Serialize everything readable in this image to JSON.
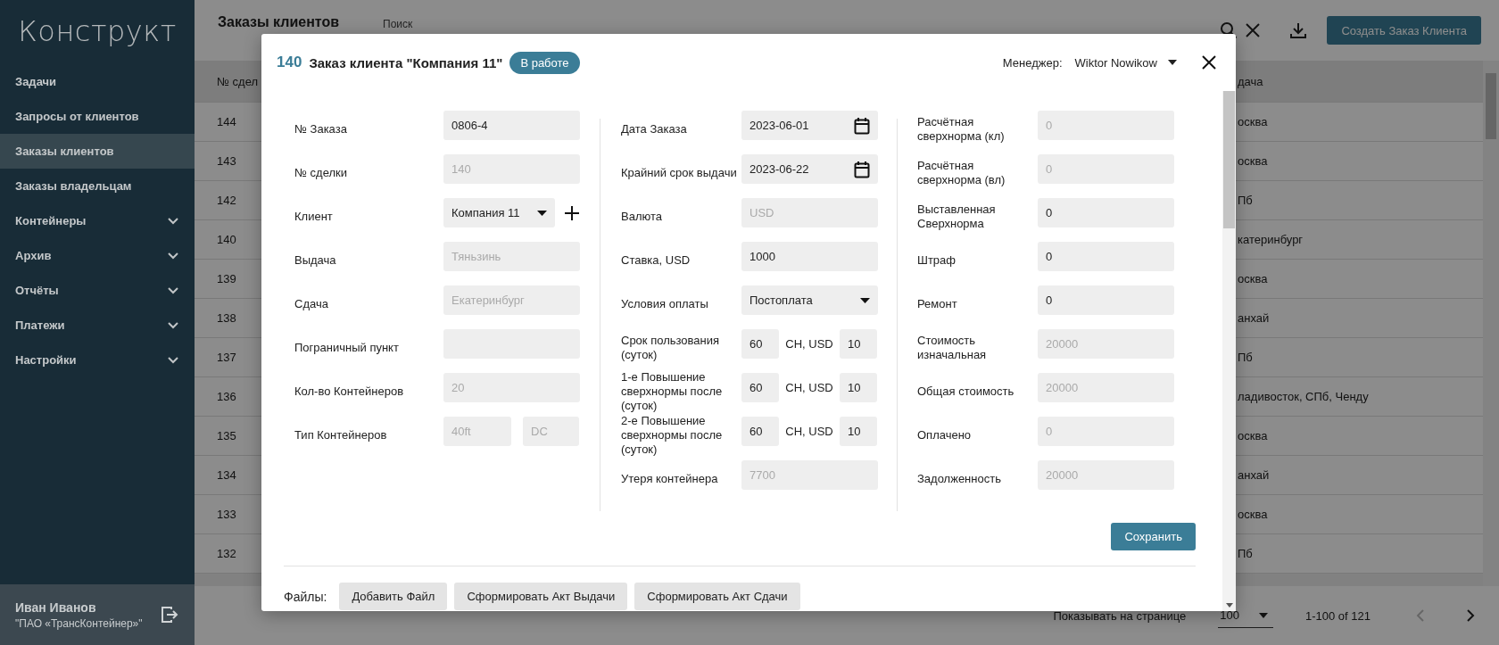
{
  "sidebar": {
    "logo": "Конструкт",
    "items": [
      {
        "label": "Задачи",
        "selected": false,
        "expandable": false
      },
      {
        "label": "Запросы от клиентов",
        "selected": false,
        "expandable": false
      },
      {
        "label": "Заказы клиентов",
        "selected": true,
        "expandable": false
      },
      {
        "label": "Заказы владельцам",
        "selected": false,
        "expandable": false
      },
      {
        "label": "Контейнеры",
        "selected": false,
        "expandable": true
      },
      {
        "label": "Архив",
        "selected": false,
        "expandable": true
      },
      {
        "label": "Отчёты",
        "selected": false,
        "expandable": true
      },
      {
        "label": "Платежи",
        "selected": false,
        "expandable": true
      },
      {
        "label": "Настройки",
        "selected": false,
        "expandable": true
      }
    ],
    "user": {
      "name": "Иван Иванов",
      "company": "\"ПАО «ТрансКонтейнер»\""
    }
  },
  "page": {
    "title": "Заказы клиентов",
    "search_placeholder": "Поиск",
    "create_button": "Создать Заказ Клиента"
  },
  "table": {
    "columns": [
      "№ сдел",
      "дача"
    ],
    "rows": [
      {
        "cells": [
          "144",
          "осква"
        ]
      },
      {
        "cells": [
          "143",
          "осква"
        ]
      },
      {
        "cells": [
          "142",
          "Пб"
        ]
      },
      {
        "cells": [
          "140",
          "катеринбург"
        ]
      },
      {
        "cells": [
          "139",
          "осква"
        ]
      },
      {
        "cells": [
          "138",
          "анхай"
        ]
      },
      {
        "cells": [
          "137",
          "Пб"
        ]
      },
      {
        "cells": [
          "136",
          "ладивосток, СПб, Ченду"
        ]
      },
      {
        "cells": [
          "135",
          "осква"
        ]
      },
      {
        "cells": [
          "134",
          "анхай"
        ]
      },
      {
        "cells": [
          "133",
          "осква"
        ]
      },
      {
        "cells": [
          "132",
          "Пб"
        ]
      }
    ]
  },
  "pagination": {
    "per_page_label": "Показывать на странице",
    "per_page": "100",
    "range": "1-100 of 121",
    "prev_disabled": true,
    "next_disabled": false
  },
  "modal": {
    "number": "140",
    "title": "Заказ клиента \"Компания 11\"",
    "status": "В работе",
    "manager_label": "Менеджер:",
    "manager": "Wiktor Nowikow",
    "columns": [
      {
        "fields": [
          {
            "label": "№ Заказа",
            "kind": "text",
            "value": "0806-4",
            "disabled": false
          },
          {
            "label": "№ сделки",
            "kind": "text",
            "value": "140",
            "disabled": true
          },
          {
            "label": "Клиент",
            "kind": "select",
            "value": "Компания 11",
            "disabled": false,
            "addable": true
          },
          {
            "label": "Выдача",
            "kind": "text",
            "value": "Тяньзинь",
            "disabled": true
          },
          {
            "label": "Сдача",
            "kind": "text",
            "value": "Екатеринбург",
            "disabled": true
          },
          {
            "label": "Пограничный пункт",
            "kind": "text"
          },
          {
            "label": "Кол-во Контейнеров",
            "kind": "text",
            "value": "20",
            "disabled": true
          },
          {
            "label": "Тип Контейнеров",
            "kind": "pair",
            "value": "40ft",
            "value2": "DC",
            "disabled": true
          }
        ]
      },
      {
        "fields": [
          {
            "label": "Дата Заказа",
            "kind": "date",
            "value": "2023-06-01",
            "disabled": false
          },
          {
            "label": "Крайний срок выдачи",
            "kind": "date",
            "value": "2023-06-22",
            "disabled": false
          },
          {
            "label": "Валюта",
            "kind": "text",
            "value": "USD",
            "disabled": true
          },
          {
            "label": "Ставка, USD",
            "kind": "text",
            "value": "1000",
            "disabled": false
          },
          {
            "label": "Условия оплаты",
            "kind": "select",
            "value": "Постоплата",
            "disabled": false
          },
          {
            "label": "Срок пользования (суток)",
            "kind": "rate",
            "value": "60",
            "unit": "CH, USD",
            "value2": "10",
            "disabled": false
          },
          {
            "label": "1-е Повышение сверхнормы после (суток)",
            "kind": "rate",
            "value": "60",
            "unit": "CH, USD",
            "value2": "10",
            "disabled": false
          },
          {
            "label": "2-е Повышение сверхнормы после (суток)",
            "kind": "rate",
            "value": "60",
            "unit": "CH, USD",
            "value2": "10",
            "disabled": false
          },
          {
            "label": "Утеря контейнера",
            "kind": "text",
            "value": "7700",
            "disabled": true
          }
        ]
      },
      {
        "fields": [
          {
            "label": "Расчётная сверхнорма (кл)",
            "kind": "text",
            "value": "0",
            "disabled": true
          },
          {
            "label": "Расчётная сверхнорма (вл)",
            "kind": "text",
            "value": "0",
            "disabled": true
          },
          {
            "label": "Выставленная Сверхнорма",
            "kind": "text",
            "value": "0",
            "disabled": false
          },
          {
            "label": "Штраф",
            "kind": "text",
            "value": "0",
            "disabled": false
          },
          {
            "label": "Ремонт",
            "kind": "text",
            "value": "0",
            "disabled": false
          },
          {
            "label": "Стоимость изначальная",
            "kind": "text",
            "value": "20000",
            "disabled": true
          },
          {
            "label": "Общая стоимость",
            "kind": "text",
            "value": "20000",
            "disabled": true
          },
          {
            "label": "Оплачено",
            "kind": "text",
            "value": "0",
            "disabled": true
          },
          {
            "label": "Задолженность",
            "kind": "text",
            "value": "20000",
            "disabled": true
          }
        ]
      }
    ],
    "save_button": "Сохранить",
    "files_label": "Файлы:",
    "file_buttons": [
      "Добавить Файл",
      "Сформировать Акт Выдачи",
      "Сформировать Акт Сдачи"
    ]
  }
}
